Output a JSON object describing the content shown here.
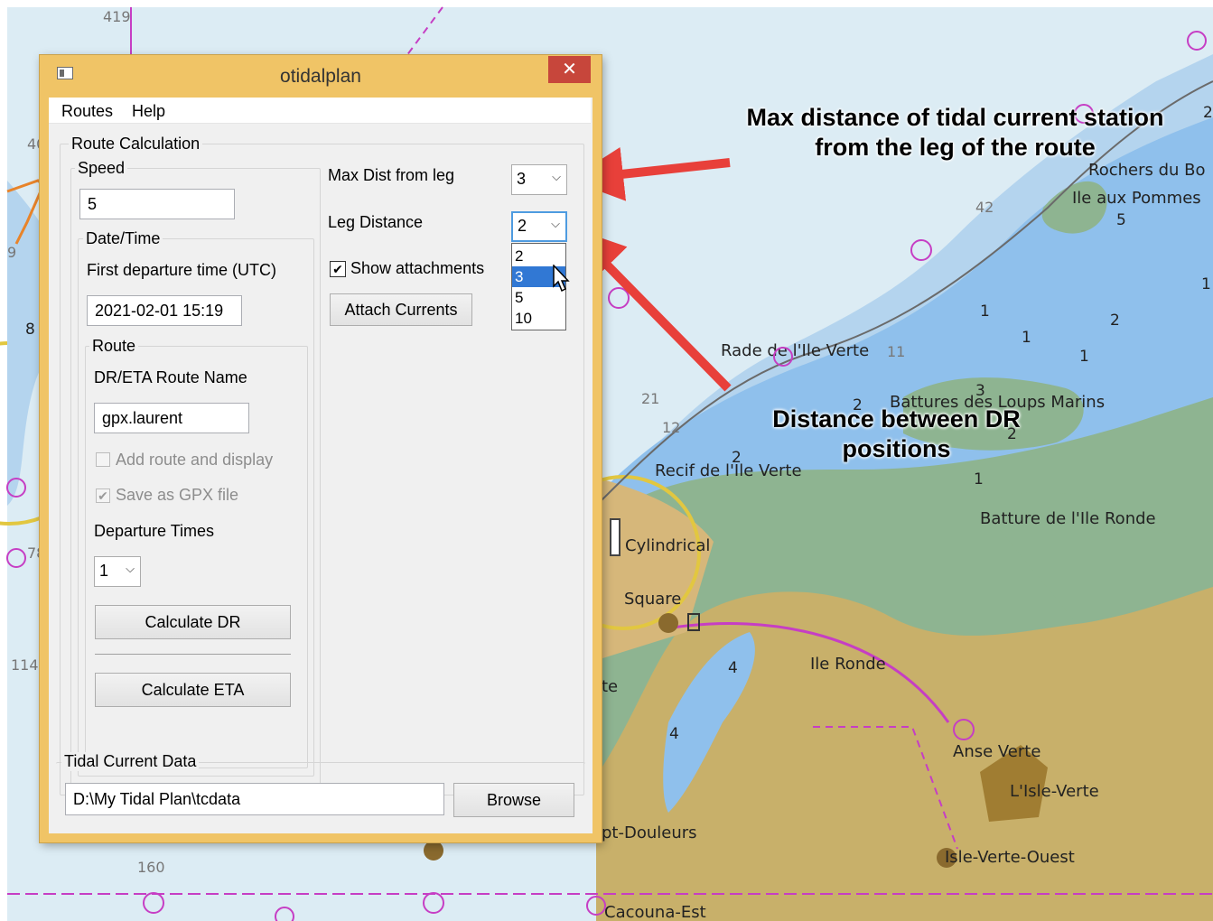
{
  "window": {
    "title": "otidalplan",
    "close_glyph": "✕",
    "menu": [
      "Routes",
      "Help"
    ]
  },
  "route_calc": {
    "group_title": "Route Calculation",
    "speed_label": "Speed",
    "speed_value": "5",
    "datetime_group": "Date/Time",
    "first_departure_label": "First departure time (UTC)",
    "first_departure_value": "2021-02-01  15:19",
    "route_group": "Route",
    "route_name_label": "DR/ETA Route Name",
    "route_name_value": "gpx.laurent",
    "add_route_label": "Add route and display",
    "add_route_checked": false,
    "save_gpx_label": "Save as GPX file",
    "save_gpx_checked": true,
    "departure_times_label": "Departure Times",
    "departure_times_value": "1",
    "calc_dr_label": "Calculate DR",
    "calc_eta_label": "Calculate ETA",
    "max_dist_label": "Max Dist from leg",
    "max_dist_value": "3",
    "leg_distance_label": "Leg Distance",
    "leg_distance_value": "2",
    "leg_distance_options": [
      "2",
      "3",
      "5",
      "10"
    ],
    "leg_distance_highlighted": "3",
    "show_attachments_label": "Show attachments",
    "show_attachments_checked": true,
    "attach_currents_label": "Attach Currents"
  },
  "tidal": {
    "group_title": "Tidal Current Data",
    "path_value": "D:\\My Tidal Plan\\tcdata",
    "browse_label": "Browse"
  },
  "annotations": {
    "max_distance": "Max distance of tidal current station from the leg of the route",
    "dr_distance": "Distance between DR positions",
    "arrow_color": "#e8403a"
  },
  "chart_map": {
    "place_names": [
      "Rochers du Bo",
      "Ile aux Pommes",
      "Rade de l'Ile Verte",
      "Battures des Loups Marins",
      "Recif de l'Ile Verte",
      "Batture de l'Ile Ronde",
      "Cylindrical",
      "Square",
      "Ile Ronde",
      "Anse Verte",
      "L'Isle-Verte",
      "Isle-Verte-Ouest",
      "pt-Douleurs",
      "Cacouna-Est",
      "te"
    ],
    "numbers": [
      "419",
      "42",
      "5",
      "40",
      "1",
      "2",
      "8",
      "21",
      "12",
      "2",
      "3",
      "1",
      "4",
      "4",
      "78",
      "114",
      "160",
      "9",
      "11",
      "2",
      "1",
      "1",
      "2"
    ],
    "colors": {
      "land": "#c8b06a",
      "shoal": "#8eb491",
      "shallow": "#8fc0ec",
      "deep": "#d7e8f2",
      "route": "#c63ec4"
    }
  }
}
